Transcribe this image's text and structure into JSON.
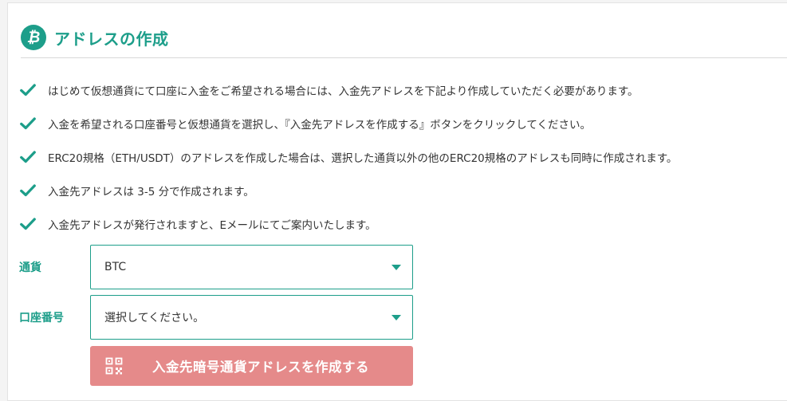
{
  "header": {
    "icon_glyph": "₿",
    "icon": "bitcoin-icon",
    "title": "アドレスの作成"
  },
  "notes": [
    "はじめて仮想通貨にて口座に入金をご希望される場合には、入金先アドレスを下記より作成していただく必要があります。",
    "入金を希望される口座番号と仮想通貨を選択し、『入金先アドレスを作成する』ボタンをクリックしてください。",
    "ERC20規格（ETH/USDT）のアドレスを作成した場合は、選択した通貨以外の他のERC20規格のアドレスも同時に作成されます。",
    "入金先アドレスは 3-5 分で作成されます。",
    "入金先アドレスが発行されますと、Eメールにてご案内いたします。"
  ],
  "form": {
    "currency": {
      "label": "通貨",
      "value": "BTC"
    },
    "account": {
      "label": "口座番号",
      "value": "選択してください。"
    },
    "submit_label": "入金先暗号通貨アドレスを作成する"
  },
  "colors": {
    "accent": "#1d9e8a",
    "button": "#e58a8a"
  }
}
